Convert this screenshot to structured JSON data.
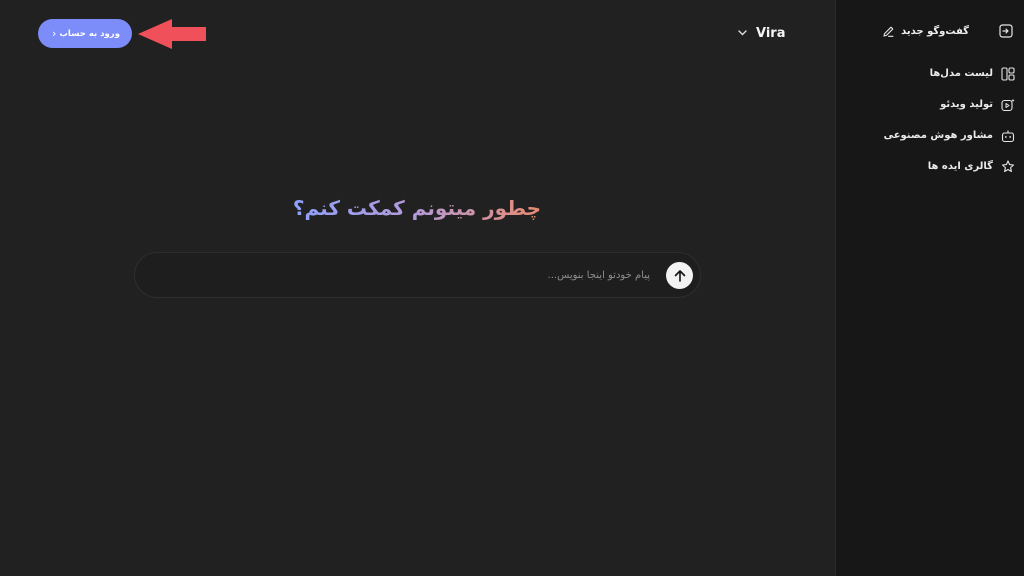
{
  "header": {
    "login_label": "ورود به حساب",
    "login_chevron": "›",
    "model_name": "Vira"
  },
  "main": {
    "greeting": "چطور میتونم کمکت کنم؟",
    "composer_placeholder": "پیام خودتو اینجا بنویس..."
  },
  "sidebar": {
    "new_chat_label": "گفت‌وگو جدید",
    "items": [
      {
        "label": "لیست مدل‌ها",
        "icon": "layout-grid-icon"
      },
      {
        "label": "تولید ویدئو",
        "icon": "video-sparkle-icon"
      },
      {
        "label": "مشاور هوش مصنوعی",
        "icon": "robot-icon"
      },
      {
        "label": "گالری ایده ها",
        "icon": "lightbulb-star-icon"
      }
    ]
  },
  "colors": {
    "accent": "#7c8cf8",
    "annotation_arrow": "#f0505a",
    "background": "#212121",
    "sidebar_background": "#171717"
  }
}
